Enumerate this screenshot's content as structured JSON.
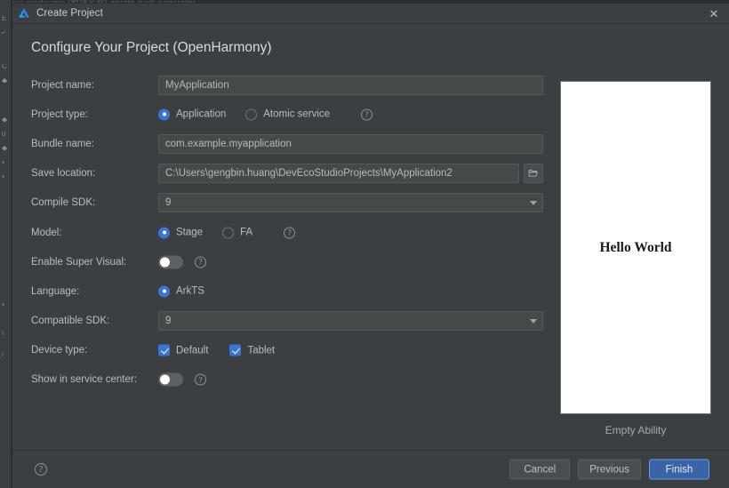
{
  "ide_background": {
    "top_strip_text": "X:nul  modname (模块名称)  zhetto-hadi  generator",
    "left_marks": [
      "E",
      "⌐",
      "C",
      "◆",
      "◆",
      "0",
      "◆",
      "▪",
      "▪",
      "▪",
      "\\",
      "|"
    ]
  },
  "titlebar": {
    "title": "Create Project",
    "logo_icon": "deveco-logo-icon",
    "close_icon": "✕"
  },
  "page_title": "Configure Your Project (OpenHarmony)",
  "form": {
    "rows": [
      {
        "label": "Project name:",
        "type": "text",
        "value": "MyApplication",
        "placeholder": ""
      },
      {
        "label": "Project type:",
        "type": "radio",
        "options": [
          "Application",
          "Atomic service"
        ],
        "selected": "Application",
        "help": true
      },
      {
        "label": "Bundle name:",
        "type": "text",
        "value": "com.example.myapplication",
        "placeholder": ""
      },
      {
        "label": "Save location:",
        "type": "text_browse",
        "value": "C:\\Users\\gengbin.huang\\DevEcoStudioProjects\\MyApplication2",
        "placeholder": "",
        "browse_icon": "folder-open-icon"
      },
      {
        "label": "Compile SDK:",
        "type": "combo",
        "value": "9"
      },
      {
        "label": "Model:",
        "type": "radio",
        "options": [
          "Stage",
          "FA"
        ],
        "selected": "Stage",
        "help": true
      },
      {
        "label": "Enable Super Visual:",
        "type": "toggle",
        "value": "off",
        "help": true
      },
      {
        "label": "Language:",
        "type": "radio",
        "options": [
          "ArkTS"
        ],
        "selected": "ArkTS",
        "help": false
      },
      {
        "label": "Compatible SDK:",
        "type": "combo",
        "value": "9"
      },
      {
        "label": "Device type:",
        "type": "checkbox",
        "options": [
          "Default",
          "Tablet"
        ],
        "checked": [
          "Default",
          "Tablet"
        ]
      },
      {
        "label": "Show in service center:",
        "type": "toggle",
        "value": "off",
        "help": true
      }
    ]
  },
  "preview": {
    "screen_text": "Hello World",
    "caption": "Empty Ability"
  },
  "footer": {
    "help_icon": "?",
    "buttons": [
      {
        "label": "Cancel",
        "primary": false
      },
      {
        "label": "Previous",
        "primary": false
      },
      {
        "label": "Finish",
        "primary": true
      }
    ]
  },
  "colors": {
    "dialog_bg": "#3c3f41",
    "field_bg": "#45494a",
    "accent_blue": "#3c74d5",
    "primary_button_bg": "#3a64a8",
    "primary_button_border": "#6f9fe6",
    "text": "#b9bdc0"
  }
}
